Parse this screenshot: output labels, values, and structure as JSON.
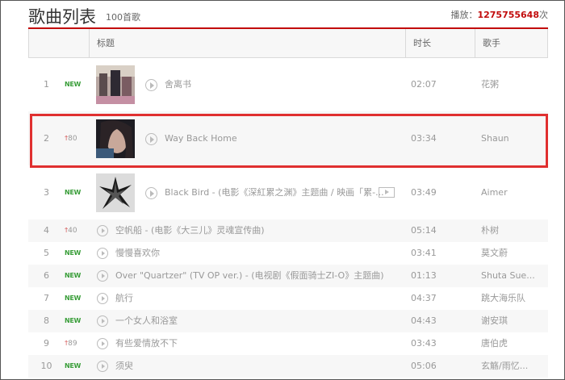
{
  "header": {
    "title": "歌曲列表",
    "count": "100首歌",
    "play_label": "播放：",
    "play_count": "1275755648",
    "play_unit": "次"
  },
  "columns": {
    "title": "标题",
    "duration": "时长",
    "artist": "歌手"
  },
  "colors": {
    "accent": "#c20c0c",
    "new_badge": "#3a9e3a",
    "highlight_box": "#e03030"
  },
  "rows": [
    {
      "num": "1",
      "change": "NEW",
      "title": "舍离书",
      "duration": "02:07",
      "artist": "花粥"
    },
    {
      "num": "2",
      "change": "80",
      "title": "Way Back Home",
      "duration": "03:34",
      "artist": "Shaun"
    },
    {
      "num": "3",
      "change": "NEW",
      "title": "Black Bird - (电影《深紅累之渊》主题曲 / 映画「累-...",
      "duration": "03:49",
      "artist": "Aimer"
    },
    {
      "num": "4",
      "change": "40",
      "title": "空帆船 - (电影《大三儿》灵魂宣传曲)",
      "duration": "05:14",
      "artist": "朴树"
    },
    {
      "num": "5",
      "change": "NEW",
      "title": "慢慢喜欢你",
      "duration": "03:41",
      "artist": "莫文蔚"
    },
    {
      "num": "6",
      "change": "NEW",
      "title": "Over \"Quartzer\" (TV OP ver.) - (电视剧《假面骑士ZI-O》主题曲)",
      "duration": "01:13",
      "artist": "Shuta Sue..."
    },
    {
      "num": "7",
      "change": "NEW",
      "title": "航行",
      "duration": "04:37",
      "artist": "跳大海乐队"
    },
    {
      "num": "8",
      "change": "NEW",
      "title": "一个女人和浴室",
      "duration": "04:43",
      "artist": "谢安琪"
    },
    {
      "num": "9",
      "change": "89",
      "title": "有些爱情放不下",
      "duration": "03:43",
      "artist": "唐伯虎"
    },
    {
      "num": "10",
      "change": "NEW",
      "title": "须臾",
      "duration": "05:06",
      "artist": "玄觞/雨忆..."
    }
  ]
}
